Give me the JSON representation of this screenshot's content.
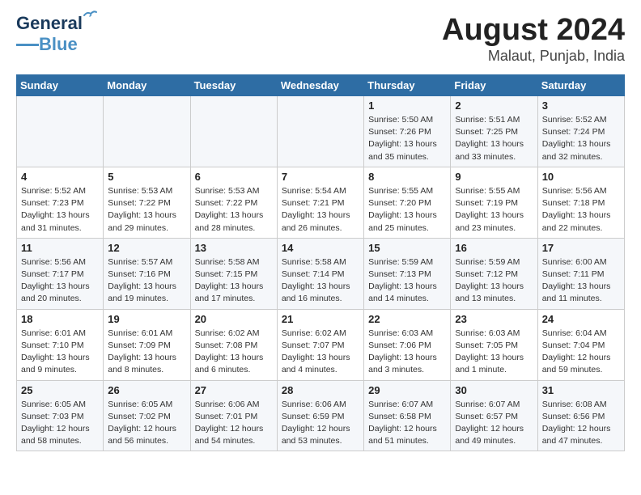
{
  "header": {
    "logo_line1": "General",
    "logo_line2": "Blue",
    "month_year": "August 2024",
    "location": "Malaut, Punjab, India"
  },
  "days_of_week": [
    "Sunday",
    "Monday",
    "Tuesday",
    "Wednesday",
    "Thursday",
    "Friday",
    "Saturday"
  ],
  "weeks": [
    [
      {
        "day": "",
        "info": ""
      },
      {
        "day": "",
        "info": ""
      },
      {
        "day": "",
        "info": ""
      },
      {
        "day": "",
        "info": ""
      },
      {
        "day": "1",
        "info": "Sunrise: 5:50 AM\nSunset: 7:26 PM\nDaylight: 13 hours\nand 35 minutes."
      },
      {
        "day": "2",
        "info": "Sunrise: 5:51 AM\nSunset: 7:25 PM\nDaylight: 13 hours\nand 33 minutes."
      },
      {
        "day": "3",
        "info": "Sunrise: 5:52 AM\nSunset: 7:24 PM\nDaylight: 13 hours\nand 32 minutes."
      }
    ],
    [
      {
        "day": "4",
        "info": "Sunrise: 5:52 AM\nSunset: 7:23 PM\nDaylight: 13 hours\nand 31 minutes."
      },
      {
        "day": "5",
        "info": "Sunrise: 5:53 AM\nSunset: 7:22 PM\nDaylight: 13 hours\nand 29 minutes."
      },
      {
        "day": "6",
        "info": "Sunrise: 5:53 AM\nSunset: 7:22 PM\nDaylight: 13 hours\nand 28 minutes."
      },
      {
        "day": "7",
        "info": "Sunrise: 5:54 AM\nSunset: 7:21 PM\nDaylight: 13 hours\nand 26 minutes."
      },
      {
        "day": "8",
        "info": "Sunrise: 5:55 AM\nSunset: 7:20 PM\nDaylight: 13 hours\nand 25 minutes."
      },
      {
        "day": "9",
        "info": "Sunrise: 5:55 AM\nSunset: 7:19 PM\nDaylight: 13 hours\nand 23 minutes."
      },
      {
        "day": "10",
        "info": "Sunrise: 5:56 AM\nSunset: 7:18 PM\nDaylight: 13 hours\nand 22 minutes."
      }
    ],
    [
      {
        "day": "11",
        "info": "Sunrise: 5:56 AM\nSunset: 7:17 PM\nDaylight: 13 hours\nand 20 minutes."
      },
      {
        "day": "12",
        "info": "Sunrise: 5:57 AM\nSunset: 7:16 PM\nDaylight: 13 hours\nand 19 minutes."
      },
      {
        "day": "13",
        "info": "Sunrise: 5:58 AM\nSunset: 7:15 PM\nDaylight: 13 hours\nand 17 minutes."
      },
      {
        "day": "14",
        "info": "Sunrise: 5:58 AM\nSunset: 7:14 PM\nDaylight: 13 hours\nand 16 minutes."
      },
      {
        "day": "15",
        "info": "Sunrise: 5:59 AM\nSunset: 7:13 PM\nDaylight: 13 hours\nand 14 minutes."
      },
      {
        "day": "16",
        "info": "Sunrise: 5:59 AM\nSunset: 7:12 PM\nDaylight: 13 hours\nand 13 minutes."
      },
      {
        "day": "17",
        "info": "Sunrise: 6:00 AM\nSunset: 7:11 PM\nDaylight: 13 hours\nand 11 minutes."
      }
    ],
    [
      {
        "day": "18",
        "info": "Sunrise: 6:01 AM\nSunset: 7:10 PM\nDaylight: 13 hours\nand 9 minutes."
      },
      {
        "day": "19",
        "info": "Sunrise: 6:01 AM\nSunset: 7:09 PM\nDaylight: 13 hours\nand 8 minutes."
      },
      {
        "day": "20",
        "info": "Sunrise: 6:02 AM\nSunset: 7:08 PM\nDaylight: 13 hours\nand 6 minutes."
      },
      {
        "day": "21",
        "info": "Sunrise: 6:02 AM\nSunset: 7:07 PM\nDaylight: 13 hours\nand 4 minutes."
      },
      {
        "day": "22",
        "info": "Sunrise: 6:03 AM\nSunset: 7:06 PM\nDaylight: 13 hours\nand 3 minutes."
      },
      {
        "day": "23",
        "info": "Sunrise: 6:03 AM\nSunset: 7:05 PM\nDaylight: 13 hours\nand 1 minute."
      },
      {
        "day": "24",
        "info": "Sunrise: 6:04 AM\nSunset: 7:04 PM\nDaylight: 12 hours\nand 59 minutes."
      }
    ],
    [
      {
        "day": "25",
        "info": "Sunrise: 6:05 AM\nSunset: 7:03 PM\nDaylight: 12 hours\nand 58 minutes."
      },
      {
        "day": "26",
        "info": "Sunrise: 6:05 AM\nSunset: 7:02 PM\nDaylight: 12 hours\nand 56 minutes."
      },
      {
        "day": "27",
        "info": "Sunrise: 6:06 AM\nSunset: 7:01 PM\nDaylight: 12 hours\nand 54 minutes."
      },
      {
        "day": "28",
        "info": "Sunrise: 6:06 AM\nSunset: 6:59 PM\nDaylight: 12 hours\nand 53 minutes."
      },
      {
        "day": "29",
        "info": "Sunrise: 6:07 AM\nSunset: 6:58 PM\nDaylight: 12 hours\nand 51 minutes."
      },
      {
        "day": "30",
        "info": "Sunrise: 6:07 AM\nSunset: 6:57 PM\nDaylight: 12 hours\nand 49 minutes."
      },
      {
        "day": "31",
        "info": "Sunrise: 6:08 AM\nSunset: 6:56 PM\nDaylight: 12 hours\nand 47 minutes."
      }
    ]
  ]
}
